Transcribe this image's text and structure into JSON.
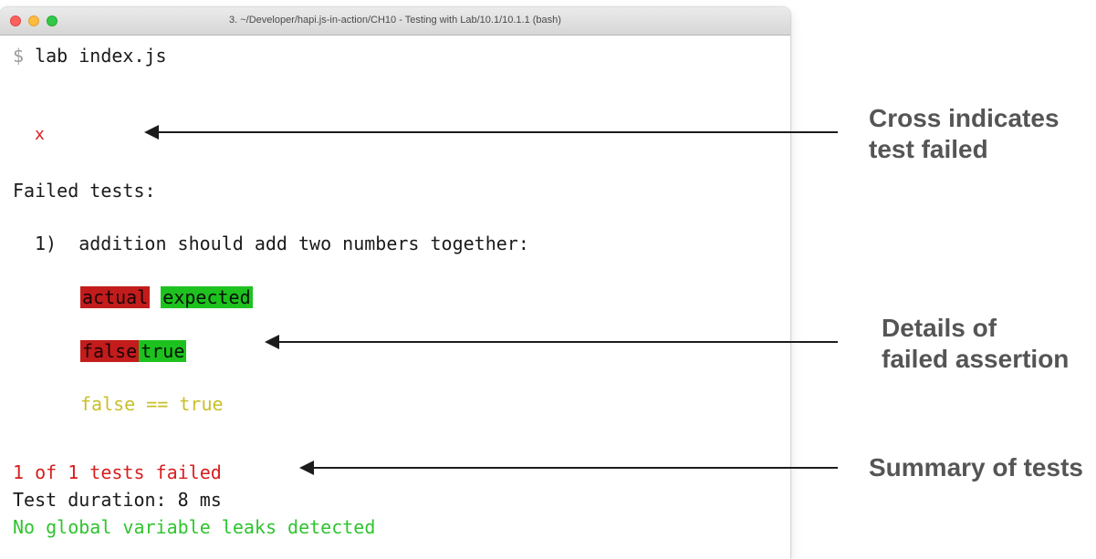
{
  "window": {
    "title": "3. ~/Developer/hapi.js-in-action/CH10 - Testing with Lab/10.1/10.1.1 (bash)"
  },
  "terminal": {
    "prompt": "$",
    "command": "lab index.js",
    "cross": "x",
    "failed_header": "Failed tests:",
    "test_number": "1)",
    "test_name": "addition should add two numbers together:",
    "actual_label": "actual",
    "expected_label": "expected",
    "diff_false": "false",
    "diff_true": "true",
    "assertion": "false == true",
    "summary": "1 of 1 tests failed",
    "duration": "Test duration: 8 ms",
    "leaks": "No global variable leaks detected"
  },
  "annotations": {
    "cross": [
      "Cross indicates",
      "test failed"
    ],
    "details": [
      "Details of",
      "failed assertion"
    ],
    "summary": [
      "Summary of tests"
    ]
  },
  "colors": {
    "fail_red": "#d81e1e",
    "pass_green": "#2fc42f",
    "assert_yellow": "#c9bf2a"
  }
}
